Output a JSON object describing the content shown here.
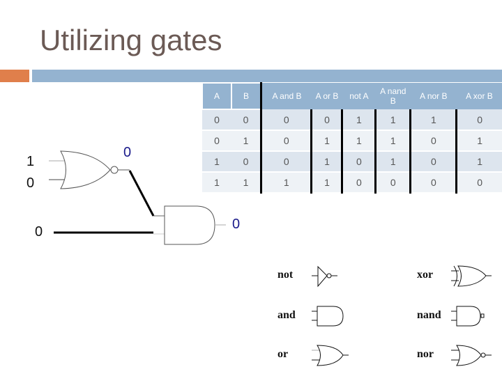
{
  "slide": {
    "title": "Utilizing gates",
    "accent_colors": {
      "orange": "#e07f4b",
      "blue": "#94b3d0"
    }
  },
  "truth_table": {
    "headers": [
      "A",
      "B",
      "A and B",
      "A or B",
      "not A",
      "A nand B",
      "A nor B",
      "A xor B"
    ],
    "rows": [
      [
        "0",
        "0",
        "0",
        "0",
        "1",
        "1",
        "1",
        "0"
      ],
      [
        "0",
        "1",
        "0",
        "1",
        "1",
        "1",
        "0",
        "1"
      ],
      [
        "1",
        "0",
        "0",
        "1",
        "0",
        "1",
        "0",
        "1"
      ],
      [
        "1",
        "1",
        "1",
        "1",
        "0",
        "0",
        "0",
        "0"
      ]
    ]
  },
  "circuit": {
    "nor_inputs": [
      "1",
      "0"
    ],
    "nor_output": "0",
    "and_second_input": "0",
    "and_output": "0"
  },
  "gate_legend": [
    {
      "name": "not",
      "icon": "not-gate-icon"
    },
    {
      "name": "and",
      "icon": "and-gate-icon"
    },
    {
      "name": "or",
      "icon": "or-gate-icon"
    },
    {
      "name": "xor",
      "icon": "xor-gate-icon"
    },
    {
      "name": "nand",
      "icon": "nand-gate-icon"
    },
    {
      "name": "nor",
      "icon": "nor-gate-icon"
    }
  ]
}
